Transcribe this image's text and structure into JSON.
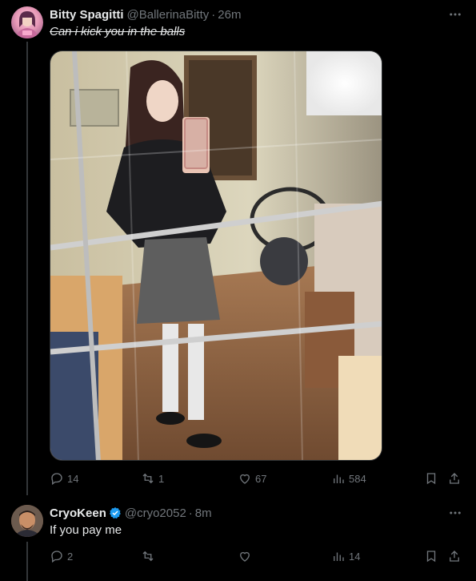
{
  "posts": [
    {
      "display_name": "Bitty Spagitti",
      "handle": "@BallerinaBitty",
      "separator": "·",
      "time": "26m",
      "text": "Can i kick you in the balls",
      "media_alt": "Mirror selfie of a woman in a black sweater and grey pleated skirt",
      "stats": {
        "replies": "14",
        "reposts": "1",
        "likes": "67",
        "views": "584"
      }
    },
    {
      "display_name": "CryoKeen",
      "handle": "@cryo2052",
      "separator": "·",
      "time": "8m",
      "text": "If you pay me",
      "stats": {
        "replies": "2",
        "reposts": "",
        "likes": "",
        "views": "14"
      }
    }
  ],
  "colors": {
    "background": "#000000",
    "text_primary": "#e7e9ea",
    "text_secondary": "#71767b",
    "verified_blue": "#1d9bf0",
    "divider": "#333639"
  },
  "icons": {
    "reply": "reply-icon",
    "repost": "repost-icon",
    "like": "heart-icon",
    "views": "views-icon",
    "bookmark": "bookmark-icon",
    "share": "share-icon",
    "more": "more-icon",
    "verified": "verified-badge-icon"
  }
}
